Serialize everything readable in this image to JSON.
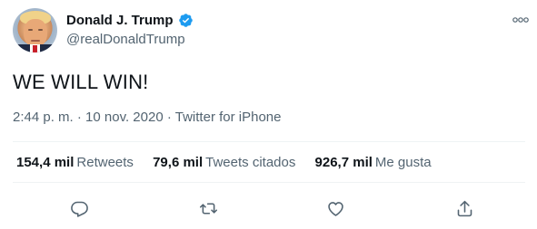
{
  "user": {
    "display_name": "Donald J. Trump",
    "handle": "@realDonaldTrump",
    "verified": true,
    "verified_color": "#1d9bf0"
  },
  "tweet": {
    "text": "WE WILL WIN!",
    "time": "2:44 p. m.",
    "separator": "·",
    "date": "10 nov. 2020",
    "source": "Twitter for iPhone"
  },
  "stats": {
    "retweets": {
      "count": "154,4 mil",
      "label": "Retweets"
    },
    "quotes": {
      "count": "79,6 mil",
      "label": "Tweets citados"
    },
    "likes": {
      "count": "926,7 mil",
      "label": "Me gusta"
    }
  },
  "actions": [
    {
      "name": "reply",
      "icon": "reply-icon"
    },
    {
      "name": "retweet",
      "icon": "retweet-icon"
    },
    {
      "name": "like",
      "icon": "heart-icon"
    },
    {
      "name": "share",
      "icon": "share-icon"
    }
  ],
  "colors": {
    "text_primary": "#0f1419",
    "text_secondary": "#536471",
    "divider": "#eff3f4"
  }
}
